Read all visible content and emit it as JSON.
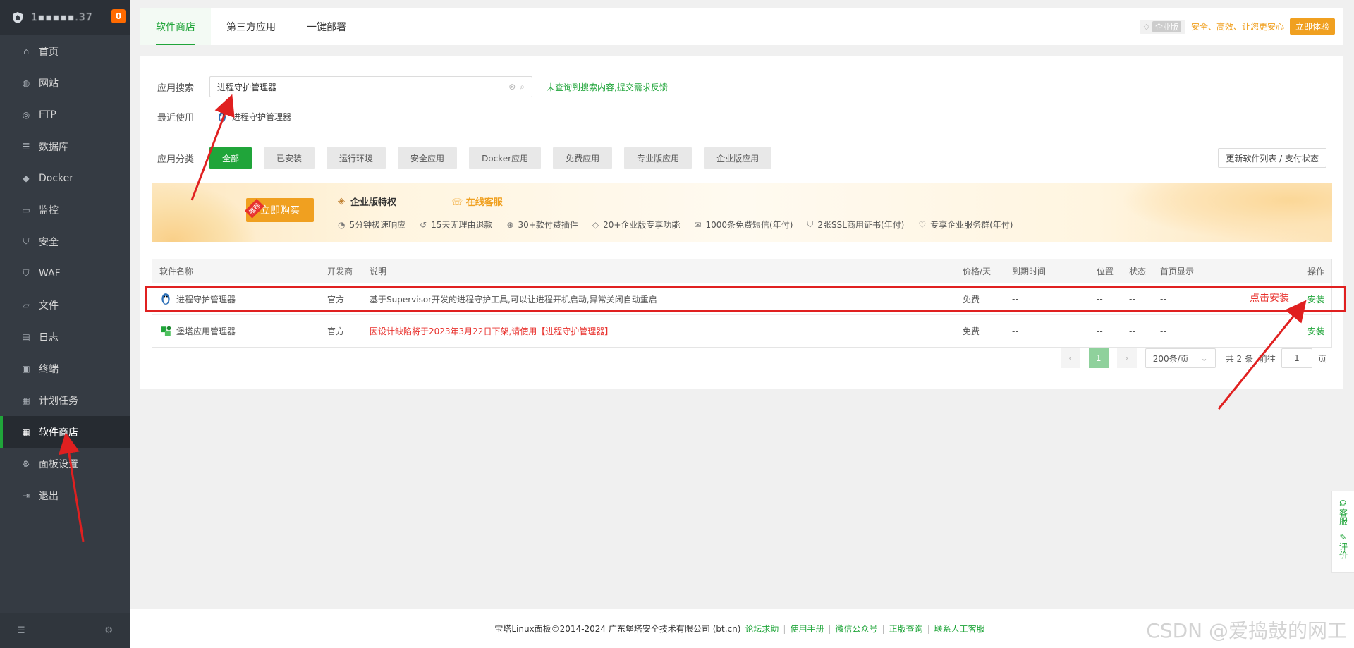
{
  "sidebar": {
    "host": "1▪▪▪▪▪.37",
    "badge": "0",
    "items": [
      {
        "label": "首页",
        "icon": "home-icon"
      },
      {
        "label": "网站",
        "icon": "globe-icon"
      },
      {
        "label": "FTP",
        "icon": "ftp-icon"
      },
      {
        "label": "数据库",
        "icon": "database-icon"
      },
      {
        "label": "Docker",
        "icon": "docker-icon"
      },
      {
        "label": "监控",
        "icon": "monitor-icon"
      },
      {
        "label": "安全",
        "icon": "shield-icon"
      },
      {
        "label": "WAF",
        "icon": "waf-icon"
      },
      {
        "label": "文件",
        "icon": "folder-icon"
      },
      {
        "label": "日志",
        "icon": "log-icon"
      },
      {
        "label": "终端",
        "icon": "terminal-icon"
      },
      {
        "label": "计划任务",
        "icon": "calendar-icon"
      },
      {
        "label": "软件商店",
        "icon": "grid-icon",
        "active": true
      },
      {
        "label": "面板设置",
        "icon": "gear-icon"
      },
      {
        "label": "退出",
        "icon": "logout-icon"
      }
    ]
  },
  "topbar": {
    "tabs": [
      "软件商店",
      "第三方应用",
      "一键部署"
    ],
    "enterprise_tag": "企业版",
    "promo_text": "安全、高效、让您更安心",
    "trial_button": "立即体验"
  },
  "search": {
    "label": "应用搜索",
    "value": "进程守护管理器",
    "feedback": "未查询到搜索内容,提交需求反馈"
  },
  "recent": {
    "label": "最近使用",
    "item": "进程守护管理器"
  },
  "categories": {
    "label": "应用分类",
    "items": [
      "全部",
      "已安装",
      "运行环境",
      "安全应用",
      "Docker应用",
      "免费应用",
      "专业版应用",
      "企业版应用"
    ],
    "update_button": "更新软件列表 / 支付状态"
  },
  "banner": {
    "ribbon": "推荐",
    "buy_button": "立即购买",
    "title": "企业版特权",
    "online_service": "在线客服",
    "features": [
      "5分钟极速响应",
      "15天无理由退款",
      "30+款付费插件",
      "20+企业版专享功能",
      "1000条免费短信(年付)",
      "2张SSL商用证书(年付)",
      "专享企业服务群(年付)"
    ]
  },
  "table": {
    "headers": [
      "软件名称",
      "开发商",
      "说明",
      "价格/天",
      "到期时间",
      "位置",
      "状态",
      "首页显示",
      "操作"
    ],
    "rows": [
      {
        "name": "进程守护管理器",
        "dev": "官方",
        "desc": "基于Supervisor开发的进程守护工具,可以让进程开机启动,异常关闭自动重启",
        "price": "免费",
        "expire": "--",
        "pos": "--",
        "status": "--",
        "home": "--",
        "op": "安装"
      },
      {
        "name": "堡塔应用管理器",
        "dev": "官方",
        "desc": "因设计缺陷将于2023年3月22日下架,请使用【进程守护管理器】",
        "price": "免费",
        "expire": "--",
        "pos": "--",
        "status": "--",
        "home": "--",
        "op": "安装"
      }
    ]
  },
  "pager": {
    "current": "1",
    "page_size": "200条/页",
    "total": "共 2 条",
    "goto_label": "前往",
    "goto_value": "1",
    "page_suffix": "页"
  },
  "annotation": "点击安装",
  "footer": {
    "copyright": "宝塔Linux面板©2014-2024 广东堡塔安全技术有限公司 (bt.cn)",
    "links": [
      "论坛求助",
      "使用手册",
      "微信公众号",
      "正版查询",
      "联系人工客服"
    ]
  },
  "float_bar": {
    "service": "客服",
    "review": "评价"
  },
  "watermark": "CSDN @爱捣鼓的网工",
  "colors": {
    "accent": "#20a53a",
    "sidebar_bg": "#353b43",
    "orange": "#f0a020",
    "red": "#e8312d"
  }
}
